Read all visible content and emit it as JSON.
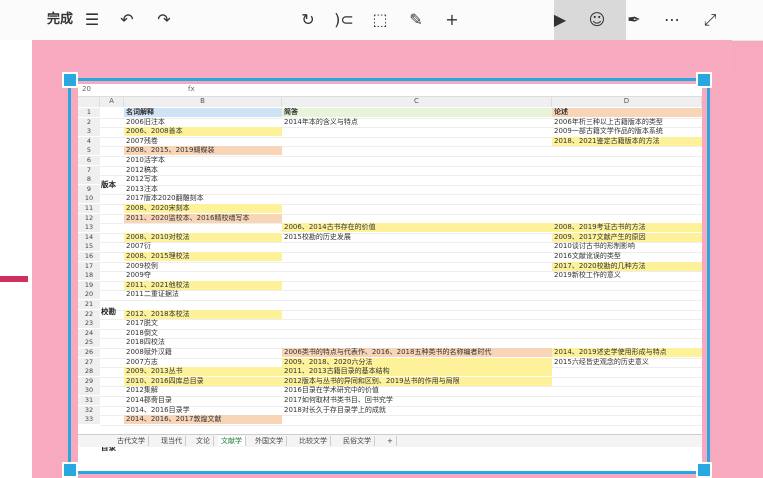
{
  "toolbar": {
    "done_label": "完成",
    "list_icon": "☰",
    "undo_icon": "↶",
    "redo_icon": "↷",
    "rotate_icon": "↻",
    "lasso_icon": ")⊂",
    "select_icon": "⬚",
    "text_icon": "⊞",
    "edit_icon": "✎",
    "add_icon": "+",
    "present_icon": "▶",
    "emoji_icon": "☺",
    "pen_icon": "✒",
    "more_icon": "⋯",
    "expand_icon": "⤢"
  },
  "sheet": {
    "cell_ref": "20",
    "fx": "fx",
    "columns": [
      "A",
      "B",
      "C",
      "D"
    ],
    "header_row": {
      "b": "名词解释",
      "c": "简答",
      "d": "论述"
    },
    "groups": [
      {
        "label": "版本"
      },
      {
        "label": "校勘"
      },
      {
        "label": "目录"
      }
    ],
    "rows": [
      {
        "n": "1"
      },
      {
        "n": "2",
        "b": "2006旧注本",
        "c": "2014年本的含义与特点",
        "d": "2006年析三种以上古籍版本的类型"
      },
      {
        "n": "3",
        "b": "2006、2008善本",
        "d": "2009一部古籍文学作品的版本系统"
      },
      {
        "n": "4",
        "b": "2007残卷",
        "d": "2018、2021鉴定古籍版本的方法"
      },
      {
        "n": "5",
        "b": "2008、2015、2019蝴蝶装"
      },
      {
        "n": "6",
        "b": "2010活字本"
      },
      {
        "n": "7",
        "b": "2012稿本"
      },
      {
        "n": "8",
        "b": "2012写本"
      },
      {
        "n": "9",
        "b": "2013注本"
      },
      {
        "n": "10",
        "b": "2017版本2020翻雕刻本"
      },
      {
        "n": "11",
        "b": "2008、2020宋刻本"
      },
      {
        "n": "12",
        "b": "2011、2020监校本、2016精校缮写本"
      },
      {
        "n": "13",
        "c": "2006、2014古书存在的价值",
        "d": "2008、2019考证古书的方法"
      },
      {
        "n": "14",
        "b": "2008、2010对校法",
        "c": "2015校勘的历史发展",
        "d": "2009、2017文献产生的原因"
      },
      {
        "n": "15",
        "b": "2007衍",
        "d": "2010谈讨古书的形制影响"
      },
      {
        "n": "16",
        "b": "2008、2015理校法",
        "d": "2016文献讹误的类型"
      },
      {
        "n": "17",
        "b": "2009校例",
        "d": "2017、2020校勘的几种方法"
      },
      {
        "n": "18",
        "b": "2009夺",
        "d": "2019新校工作的意义"
      },
      {
        "n": "19",
        "b": "2011、2021他校法"
      },
      {
        "n": "20",
        "b": "2011二重证据法"
      },
      {
        "n": "21"
      },
      {
        "n": "22",
        "b": "2012、2018本校法"
      },
      {
        "n": "23",
        "b": "2017脱文"
      },
      {
        "n": "24",
        "b": "2018倒文"
      },
      {
        "n": "25",
        "b": "2018四校法"
      },
      {
        "n": "26",
        "b": "2008赋外汉籍",
        "c": "2006类书的特点与代表作、2016、2018五种类书的名称编者时代",
        "d": "2014、2019述史学使用形成与特点"
      },
      {
        "n": "27",
        "b": "2007方志",
        "c": "2009、2018、2020六分法",
        "d": "2015六经皆史观念的历史意义"
      },
      {
        "n": "28",
        "b": "2009、2013丛书",
        "c": "2011、2013古籍目录的基本结构"
      },
      {
        "n": "29",
        "b": "2010、2016四库总目录",
        "c": "2012版本与丛书的异同和区别、2019丛书的作用与局限"
      },
      {
        "n": "30",
        "b": "2012集解",
        "c": "2016目录在学术研究中的价值"
      },
      {
        "n": "31",
        "b": "2014郡斋目录",
        "c": "2017如何取材书类书目、回书究学"
      },
      {
        "n": "32",
        "b": "2014、2016目录学",
        "c": "2018对长久于存目录学上的成就"
      },
      {
        "n": "33",
        "b": "2014、2016、2017敦煌文献"
      }
    ],
    "tabs": [
      "古代文学",
      "现当代",
      "文论",
      "文献学",
      "外国文学",
      "比较文学",
      "民俗文学",
      "+"
    ]
  }
}
